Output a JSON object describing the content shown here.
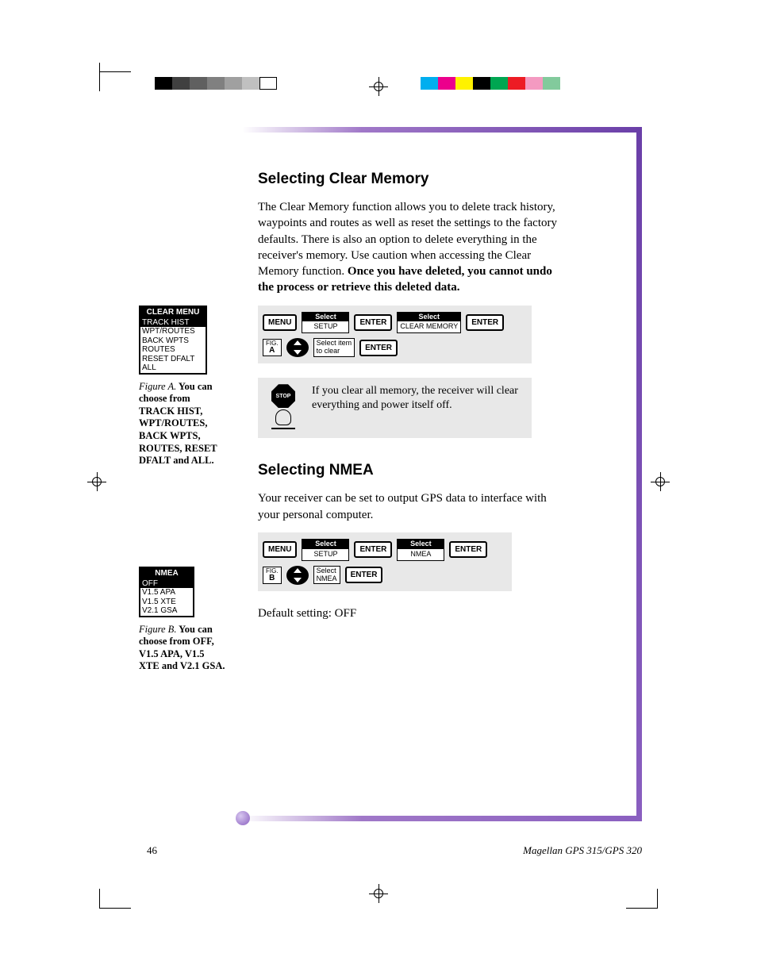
{
  "registration_colors_left": [
    "#000000",
    "#404040",
    "#606060",
    "#808080",
    "#a0a0a0",
    "#c0c0c0",
    "#ffffff"
  ],
  "registration_colors_right": [
    "#00aeef",
    "#ec008c",
    "#fff200",
    "#000000",
    "#00a651",
    "#ed1c24",
    "#f49ac1",
    "#82ca9c"
  ],
  "section1": {
    "heading": "Selecting Clear Memory",
    "para_a": "The Clear Memory function allows you to delete track history, waypoints and routes as well as reset the settings to the factory defaults.  There is also an option to delete everything in the receiver's memory.  Use caution when accessing the Clear Memory function.  ",
    "para_b_bold": "Once you have deleted, you cannot undo the process or retrieve this deleted data.",
    "diagram": {
      "menu": "MENU",
      "sel1_lbl": "Select",
      "sel1_val": "SETUP",
      "enter": "ENTER",
      "sel2_lbl": "Select",
      "sel2_val": "CLEAR MEMORY",
      "fig_lbl": "FIG.",
      "fig_val": "A",
      "arrow_lbl": "Select item\nto clear"
    },
    "stop_note": "If you clear all memory, the receiver will clear everything and power itself off.",
    "stop_sign": "STOP"
  },
  "figA": {
    "screen_title": "CLEAR MENU",
    "rows": [
      {
        "t": "TRACK HIST",
        "hl": true
      },
      {
        "t": "WPT/ROUTES",
        "hl": false
      },
      {
        "t": "BACK WPTS",
        "hl": false
      },
      {
        "t": "ROUTES",
        "hl": false
      },
      {
        "t": "RESET DFALT",
        "hl": false
      },
      {
        "t": "ALL",
        "hl": false
      }
    ],
    "caption_label": "Figure A.",
    "caption_body": "  You can choose from TRACK HIST, WPT/ROUTES, BACK WPTS, ROUTES, RESET DFALT and ALL."
  },
  "section2": {
    "heading": "Selecting NMEA",
    "para": "Your receiver can be set to output GPS data to interface with your personal computer.",
    "diagram": {
      "menu": "MENU",
      "sel1_lbl": "Select",
      "sel1_val": "SETUP",
      "enter": "ENTER",
      "sel2_lbl": "Select",
      "sel2_val": "NMEA",
      "fig_lbl": "FIG.",
      "fig_val": "B",
      "arrow_lbl": "Select\nNMEA"
    },
    "default_line": "Default setting:  OFF"
  },
  "figB": {
    "screen_title": "NMEA",
    "rows": [
      {
        "t": "OFF",
        "hl": true
      },
      {
        "t": "V1.5 APA",
        "hl": false
      },
      {
        "t": "V1.5 XTE",
        "hl": false
      },
      {
        "t": "V2.1 GSA",
        "hl": false
      }
    ],
    "caption_label": "Figure B.",
    "caption_body": "  You can choose from OFF, V1.5 APA, V1.5 XTE and V2.1 GSA."
  },
  "footer": {
    "page": "46",
    "doc": "Magellan GPS 315/GPS 320"
  }
}
